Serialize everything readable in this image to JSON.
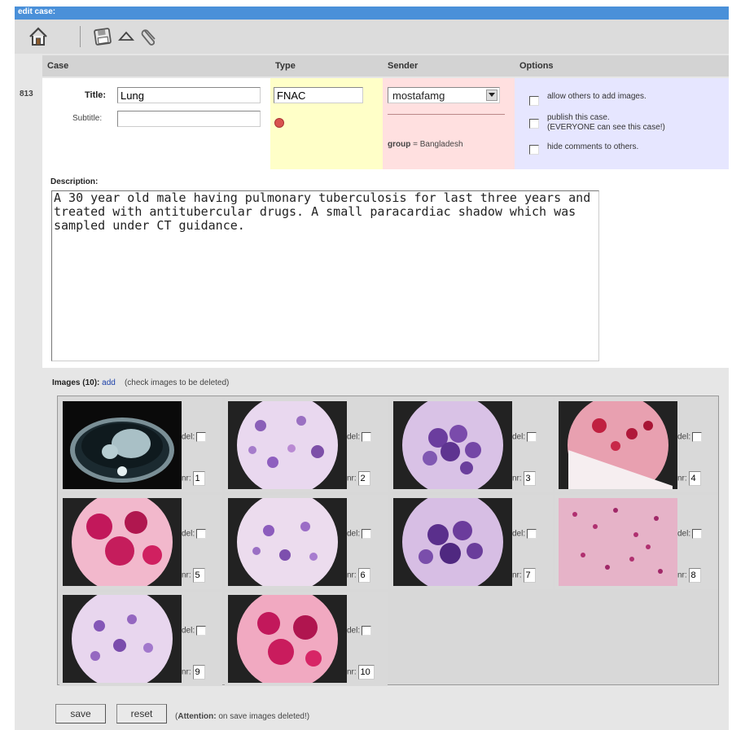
{
  "window": {
    "title": "edit case:"
  },
  "table": {
    "headers": {
      "case": "Case",
      "type": "Type",
      "sender": "Sender",
      "options": "Options"
    }
  },
  "case": {
    "id": "813",
    "title_label": "Title:",
    "title_value": "Lung",
    "subtitle_label": "Subtitle:",
    "subtitle_value": "",
    "type_value": "FNAC",
    "sender_value": "mostafamg",
    "group_label": "group",
    "group_value": "= Bangladesh",
    "options": [
      "allow others to add images.",
      "publish this case.",
      "(EVERYONE can see this case!)",
      "hide comments to others."
    ]
  },
  "description": {
    "label": "Description:",
    "text": "A 30 year old male having pulmonary tuberculosis for last three years and treated with antitubercular drugs. A small paracardiac shadow which was sampled under CT guidance."
  },
  "images": {
    "label": "Images (10):",
    "add_link": "add",
    "hint": "(check images to be deleted)",
    "del_label": "del:",
    "nr_label": "nr:",
    "items": [
      {
        "nr": "1",
        "kind": "ct-scan"
      },
      {
        "nr": "2",
        "kind": "cytology-pale"
      },
      {
        "nr": "3",
        "kind": "cytology-purple"
      },
      {
        "nr": "4",
        "kind": "cytology-red"
      },
      {
        "nr": "5",
        "kind": "cytology-magenta"
      },
      {
        "nr": "6",
        "kind": "cytology-pale"
      },
      {
        "nr": "7",
        "kind": "cytology-purple"
      },
      {
        "nr": "8",
        "kind": "cytology-pink"
      },
      {
        "nr": "9",
        "kind": "cytology-pale"
      },
      {
        "nr": "10",
        "kind": "cytology-magenta"
      }
    ]
  },
  "footer": {
    "save_label": "save",
    "reset_label": "reset",
    "attention_bold": "Attention:",
    "attention_text": "on save images deleted!)",
    "attention_open": "("
  },
  "colors": {
    "titlebar": "#4a90d9",
    "type_bg": "#ffffc8",
    "sender_bg": "#ffe0e0",
    "options_bg": "#e6e6ff"
  },
  "icons": [
    "home-icon",
    "save-icon",
    "upload-icon",
    "attach-icon",
    "status-dot-icon",
    "dropdown-arrow-icon"
  ]
}
